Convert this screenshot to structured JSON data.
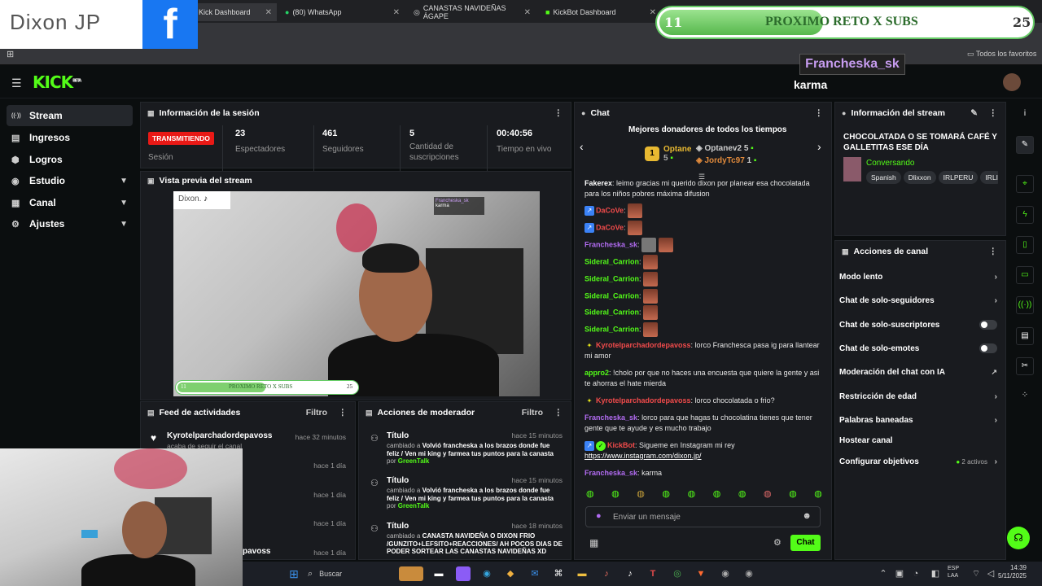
{
  "browser": {
    "tabs": [
      {
        "label": "Kick Dashboard"
      },
      {
        "label": "(80) WhatsApp"
      },
      {
        "label": "CANASTAS NAVIDEÑAS ÁGAPE"
      },
      {
        "label": "KickBot Dashboard"
      }
    ],
    "bookmarks_all": "Todos los favoritos"
  },
  "overlay": {
    "logo_text": "Dixon JP",
    "fb_glyph": "f",
    "goal_current": "11",
    "goal_title": "PROXIMO RETO X SUBS",
    "goal_target": "25",
    "goal_progress": 0.44,
    "alert_name": "Francheska_sk",
    "alert_msg": "karma"
  },
  "kick": {
    "logo": "KICK",
    "logo_sup": "BETA"
  },
  "sidebar": {
    "items": [
      {
        "label": "Stream",
        "icon": "stream-icon",
        "glyph": "((·))"
      },
      {
        "label": "Ingresos",
        "icon": "money-icon",
        "glyph": "▤"
      },
      {
        "label": "Logros",
        "icon": "trophy-icon",
        "glyph": "⬢"
      },
      {
        "label": "Estudio",
        "icon": "studio-icon",
        "glyph": "◉"
      },
      {
        "label": "Canal",
        "icon": "channel-icon",
        "glyph": "▦"
      },
      {
        "label": "Ajustes",
        "icon": "settings-icon",
        "glyph": "⚙"
      }
    ]
  },
  "session": {
    "title": "Información de la sesión",
    "live_badge": "TRANSMITIENDO",
    "live_label": "Sesión",
    "stats": [
      {
        "value": "23",
        "label": "Espectadores"
      },
      {
        "value": "461",
        "label": "Seguidores"
      },
      {
        "value": "5",
        "label": "Cantidad de suscripciones"
      },
      {
        "value": "00:40:56",
        "label": "Tiempo en vivo"
      }
    ]
  },
  "preview": {
    "title": "Vista previa del stream",
    "watermark": "Dixon.",
    "mini_name": "Francheska_sk",
    "mini_msg": "karma",
    "mini_goal_l": "11",
    "mini_goal_title": "PROXIMO RETO X SUBS",
    "mini_goal_r": "25"
  },
  "feed": {
    "title": "Feed de actividades",
    "filter": "Filtro",
    "items": [
      {
        "name": "Kyrotelparchadordepavoss",
        "sub": "acaba de seguir el canal",
        "time": "hace 32 minutos"
      },
      {
        "name": "",
        "sub": "",
        "time": "hace 1 día"
      },
      {
        "name": "",
        "sub": "",
        "time": "hace 1 día"
      },
      {
        "name": "",
        "sub": "",
        "time": "hace 1 día"
      },
      {
        "name": "pavoss",
        "sub": "",
        "time": "hace 1 día"
      }
    ]
  },
  "mod": {
    "title": "Acciones de moderador",
    "filter": "Filtro",
    "items": [
      {
        "t": "Título",
        "time": "hace 15 minutos",
        "pre": "cambiado a",
        "text": "Volvió francheska a los brazos donde fue feliz / Ven mi king y farmea tus puntos para la canasta",
        "por": "por",
        "user": "GreenTalk"
      },
      {
        "t": "Título",
        "time": "hace 15 minutos",
        "pre": "cambiado a",
        "text": "Volvió francheska a los brazos donde fue feliz / Ven mi king y farmea tus puntos para la canasta",
        "por": "por",
        "user": "GreenTalk"
      },
      {
        "t": "Título",
        "time": "hace 18 minutos",
        "pre": "cambiado a",
        "text": "CANASTA NAVIDEÑA O DIXON FRIO /GUNZITO+LEFSITO+REACCIONES/ AH POCOS DIAS DE PODER SORTEAR LAS CANASTAS NAVIDEÑAS XD",
        "por": "",
        "user": ""
      }
    ]
  },
  "chat": {
    "title": "Chat",
    "donors_title": "Mejores donadores de todos los tiempos",
    "donors": [
      {
        "name": "Optane",
        "amount": "5",
        "color": "#e8b931"
      },
      {
        "name": "Optanev2",
        "amount": "5",
        "color": "#cccccc"
      },
      {
        "name": "JordyTc97",
        "amount": "1",
        "color": "#e08a3c"
      }
    ],
    "rank_badge": "1",
    "messages": [
      {
        "user": "Fakerex",
        "color": "#ffffff",
        "text": "leimo gracias mi querido dixon por planear esa chocolatada para los niños pobres máxima difusion",
        "emotes": 0
      },
      {
        "user": "DaCoVe",
        "color": "#f24b4b",
        "text": "",
        "emotes": 1
      },
      {
        "user": "DaCoVe",
        "color": "#f24b4b",
        "text": "",
        "emotes": 1
      },
      {
        "user": "Francheska_sk",
        "color": "#b26bf2",
        "text": "",
        "emotes": 2
      },
      {
        "user": "Sideral_Carrion",
        "color": "#53fc18",
        "text": "",
        "emotes": 1
      },
      {
        "user": "Sideral_Carrion",
        "color": "#53fc18",
        "text": "",
        "emotes": 1
      },
      {
        "user": "Sideral_Carrion",
        "color": "#53fc18",
        "text": "",
        "emotes": 1
      },
      {
        "user": "Sideral_Carrion",
        "color": "#53fc18",
        "text": "",
        "emotes": 1
      },
      {
        "user": "Sideral_Carrion",
        "color": "#53fc18",
        "text": "",
        "emotes": 1
      },
      {
        "user": "Kyrotelparchadordepavoss",
        "color": "#f24b4b",
        "text": "lorco Franchesca pasa ig para llantear mi amor",
        "emotes": 0
      },
      {
        "user": "appro2",
        "color": "#53fc18",
        "text": "!cholo por que no haces una encuesta que quiere la gente y asi te ahorras el hate mierda",
        "emotes": 0
      },
      {
        "user": "Kyrotelparchadordepavoss",
        "color": "#f24b4b",
        "text": "lorco chocolatada o frio?",
        "emotes": 0
      },
      {
        "user": "Francheska_sk",
        "color": "#b26bf2",
        "text": "lorco para que hagas tu chocolatina tienes que tener gente que te ayude y es mucho trabajo",
        "emotes": 0
      },
      {
        "user": "KickBot",
        "color": "#f24b4b",
        "text": "Sigueme en Instagram mi rey",
        "link": "https://www.instagram.com/dixon.jp/",
        "emotes": 0
      },
      {
        "user": "Francheska_sk",
        "color": "#b26bf2",
        "text": "karma",
        "emotes": 0
      }
    ],
    "input_placeholder": "Enviar un mensaje",
    "send_label": "Chat"
  },
  "stream_info": {
    "title": "Información del stream",
    "stream_title": "CHOCOLATADA O SE TOMARÁ CAFÉ Y GALLETITAS ESE DÍA",
    "category": "Conversando",
    "tags": [
      "Spanish",
      "Dlixxon",
      "IRLPERU",
      "IRLI"
    ]
  },
  "channel_actions": {
    "title": "Acciones de canal",
    "items": [
      {
        "label": "Modo lento",
        "kind": "arrow"
      },
      {
        "label": "Chat de solo-seguidores",
        "kind": "arrow"
      },
      {
        "label": "Chat de solo-suscriptores",
        "kind": "toggle"
      },
      {
        "label": "Chat de solo-emotes",
        "kind": "toggle"
      },
      {
        "label": "Moderación del chat con IA",
        "kind": "external"
      },
      {
        "label": "Restricción de edad",
        "kind": "arrow"
      },
      {
        "label": "Palabras baneadas",
        "kind": "arrow"
      },
      {
        "label": "Hostear canal",
        "kind": "none"
      },
      {
        "label": "Configurar objetivos",
        "kind": "arrow",
        "extra": "2 activos"
      }
    ]
  },
  "taskbar": {
    "search": "Buscar",
    "lang": "ESP",
    "lang2": "LAA",
    "time": "14:39",
    "date": "5/11/2025"
  },
  "colors": {
    "accent": "#53fc18",
    "live": "#e91916",
    "bg": "#0b0e0f",
    "panel": "#191b1f"
  }
}
